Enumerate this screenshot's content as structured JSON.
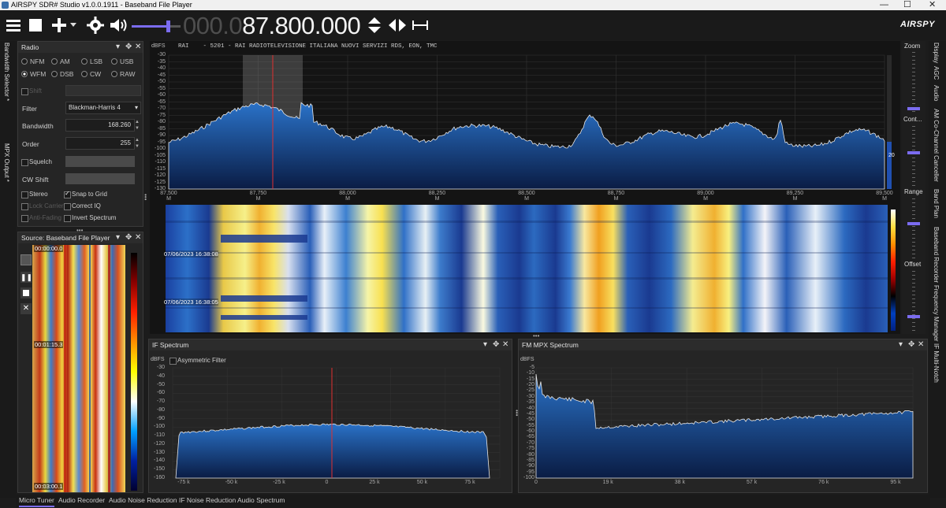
{
  "window": {
    "title": "AIRSPY SDR# Studio v1.0.0.1911 - Baseband File Player",
    "minimize": "—",
    "maximize": "☐",
    "close": "✕"
  },
  "toolbar": {
    "frequency_dim": "000.0",
    "frequency_main": "87.800.000",
    "logo": "AIRSPY"
  },
  "left_tabs": {
    "bandwidth_selector": "Bandwidth Selector *",
    "mpx_output": "MPX Output *"
  },
  "radio_panel": {
    "title": "Radio",
    "modes_row1": [
      "NFM",
      "AM",
      "LSB",
      "USB"
    ],
    "modes_row2": [
      "WFM",
      "DSB",
      "CW",
      "RAW"
    ],
    "selected_mode": "WFM",
    "shift_label": "Shift",
    "filter_label": "Filter",
    "filter_value": "Blackman-Harris 4",
    "bandwidth_label": "Bandwidth",
    "bandwidth_value": "168.260",
    "order_label": "Order",
    "order_value": "255",
    "squelch_label": "Squelch",
    "cw_shift_label": "CW Shift",
    "stereo_label": "Stereo",
    "snap_to_grid_label": "Snap to Grid",
    "lock_carrier_label": "Lock Carrier",
    "correct_iq_label": "Correct IQ",
    "anti_fading_label": "Anti-Fading",
    "invert_spectrum_label": "Invert Spectrum"
  },
  "source_panel": {
    "title": "Source: Baseband File Player",
    "time_marks": [
      "00:00:00.0",
      "00:01:15.3",
      "00:03:00.1"
    ]
  },
  "main_spectrum": {
    "unit": "dBFS",
    "rds_text": "RAI    - 5201 - RAI RADIOTELEVISIONE ITALIANA NUOVI SERVIZI RDS, EON, TMC",
    "y_ticks": [
      "-30",
      "-35",
      "-40",
      "-45",
      "-50",
      "-55",
      "-60",
      "-65",
      "-70",
      "-75",
      "-80",
      "-85",
      "-90",
      "-95",
      "-100",
      "-105",
      "-110",
      "-115",
      "-120",
      "-125",
      "-130"
    ],
    "x_ticks": [
      "87,500 M",
      "87,750 M",
      "88,000 M",
      "88,250 M",
      "88,500 M",
      "88,750 M",
      "89,000 M",
      "89,250 M",
      "89,500 M"
    ],
    "right_value": "20"
  },
  "waterfall": {
    "timestamps": [
      "07/06/2023 16:38:08",
      "07/06/2023 16:38:05"
    ]
  },
  "right_controls": {
    "zoom": "Zoom",
    "contrast": "Cont...",
    "range": "Range",
    "offset": "Offset"
  },
  "right_tabs": [
    "Display",
    "AGC",
    "Audio",
    "AM Co-Channel Canceller",
    "Band Plan",
    "Baseband Recorder",
    "Frequency Manager",
    "IF Multi-Notch"
  ],
  "if_spectrum": {
    "title": "IF Spectrum",
    "unit": "dBFS",
    "asym_label": "Asymmetric Filter",
    "y_ticks": [
      "-30",
      "-40",
      "-50",
      "-60",
      "-70",
      "-80",
      "-90",
      "-100",
      "-110",
      "-120",
      "-130",
      "-140",
      "-150",
      "-160"
    ],
    "x_ticks": [
      "-75 k",
      "-50 k",
      "-25 k",
      "0",
      "25 k",
      "50 k",
      "75 k"
    ]
  },
  "mpx_spectrum": {
    "title": "FM MPX Spectrum",
    "unit": "dBFS",
    "y_ticks": [
      "-5",
      "-10",
      "-15",
      "-20",
      "-25",
      "-30",
      "-35",
      "-40",
      "-45",
      "-50",
      "-55",
      "-60",
      "-65",
      "-70",
      "-75",
      "-80",
      "-85",
      "-90",
      "-95",
      "-100"
    ],
    "x_ticks": [
      "0",
      "19 k",
      "38 k",
      "57 k",
      "76 k",
      "95 k"
    ]
  },
  "bottom_tabs": [
    "Micro Tuner",
    "Audio Recorder",
    "Audio Noise Reduction",
    "IF Noise Reduction",
    "Audio Spectrum"
  ],
  "colors": {
    "accent": "#7b6cf0",
    "spectrum_fill": "#1f5fae",
    "marker": "#e03030"
  }
}
